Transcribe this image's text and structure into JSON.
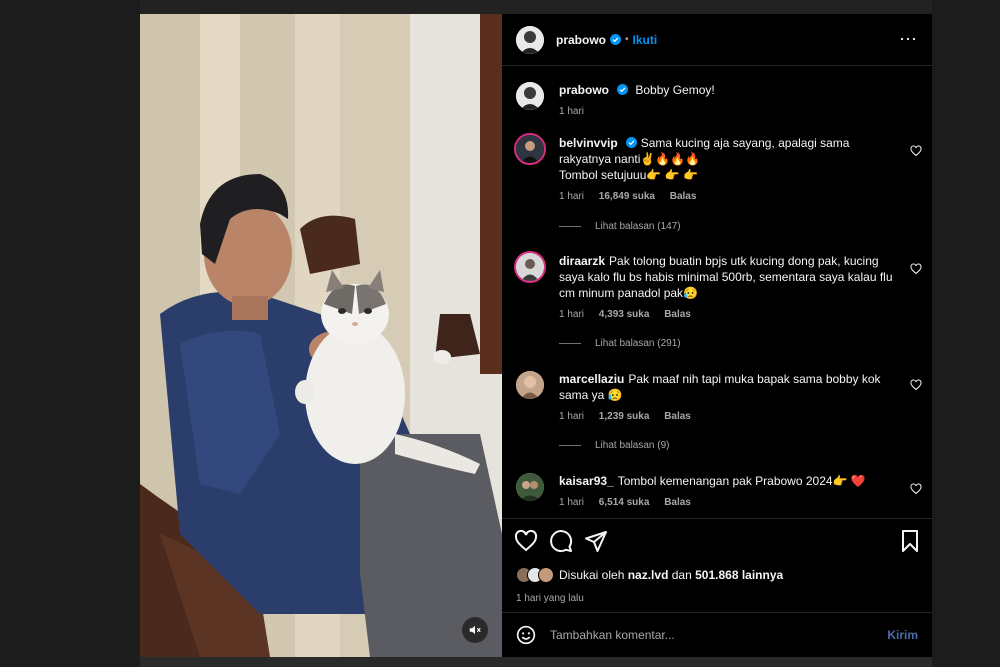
{
  "post": {
    "author": "prabowo",
    "follow_label": "Ikuti",
    "more_icon": "more-horizontal-icon",
    "caption": "Bobby Gemoy!",
    "caption_time": "1 hari"
  },
  "comments": [
    {
      "user": "belvinvvip",
      "verified": true,
      "text": "Sama kucing aja sayang, apalagi sama rakyatnya nanti✌️🔥🔥🔥",
      "text2": "Tombol setujuuu👉 👉 👉",
      "time": "1 hari",
      "likes": "16,849 suka",
      "reply_label": "Balas",
      "view_replies": "Lihat balasan (147)"
    },
    {
      "user": "diraarzk",
      "text": "Pak tolong buatin bpjs utk kucing dong pak, kucing saya kalo flu bs habis minimal 500rb, sementara saya kalau flu cm minum panadol pak😥",
      "time": "1 hari",
      "likes": "4,393 suka",
      "reply_label": "Balas",
      "view_replies": "Lihat balasan (291)"
    },
    {
      "user": "marcellaziu",
      "text": "Pak maaf nih tapi muka bapak sama bobby kok sama ya 😥",
      "time": "1 hari",
      "likes": "1,239 suka",
      "reply_label": "Balas",
      "view_replies": "Lihat balasan (9)"
    },
    {
      "user": "kaisar93_",
      "text": "Tombol kemenangan pak Prabowo 2024👉 ❤️",
      "time": "1 hari",
      "likes": "6,514 suka",
      "reply_label": "Balas"
    }
  ],
  "likes": {
    "prefix": "Disukai oleh",
    "user": "naz.lvd",
    "connector": "dan",
    "count": "501.868 lainnya"
  },
  "time_ago": "1 hari yang lalu",
  "composer": {
    "placeholder": "Tambahkan komentar...",
    "send_label": "Kirim"
  },
  "colors": {
    "accent": "#0095f6",
    "verified": "#0095f6",
    "story_ring": "#d92e7f",
    "heart": "#ff3040"
  }
}
